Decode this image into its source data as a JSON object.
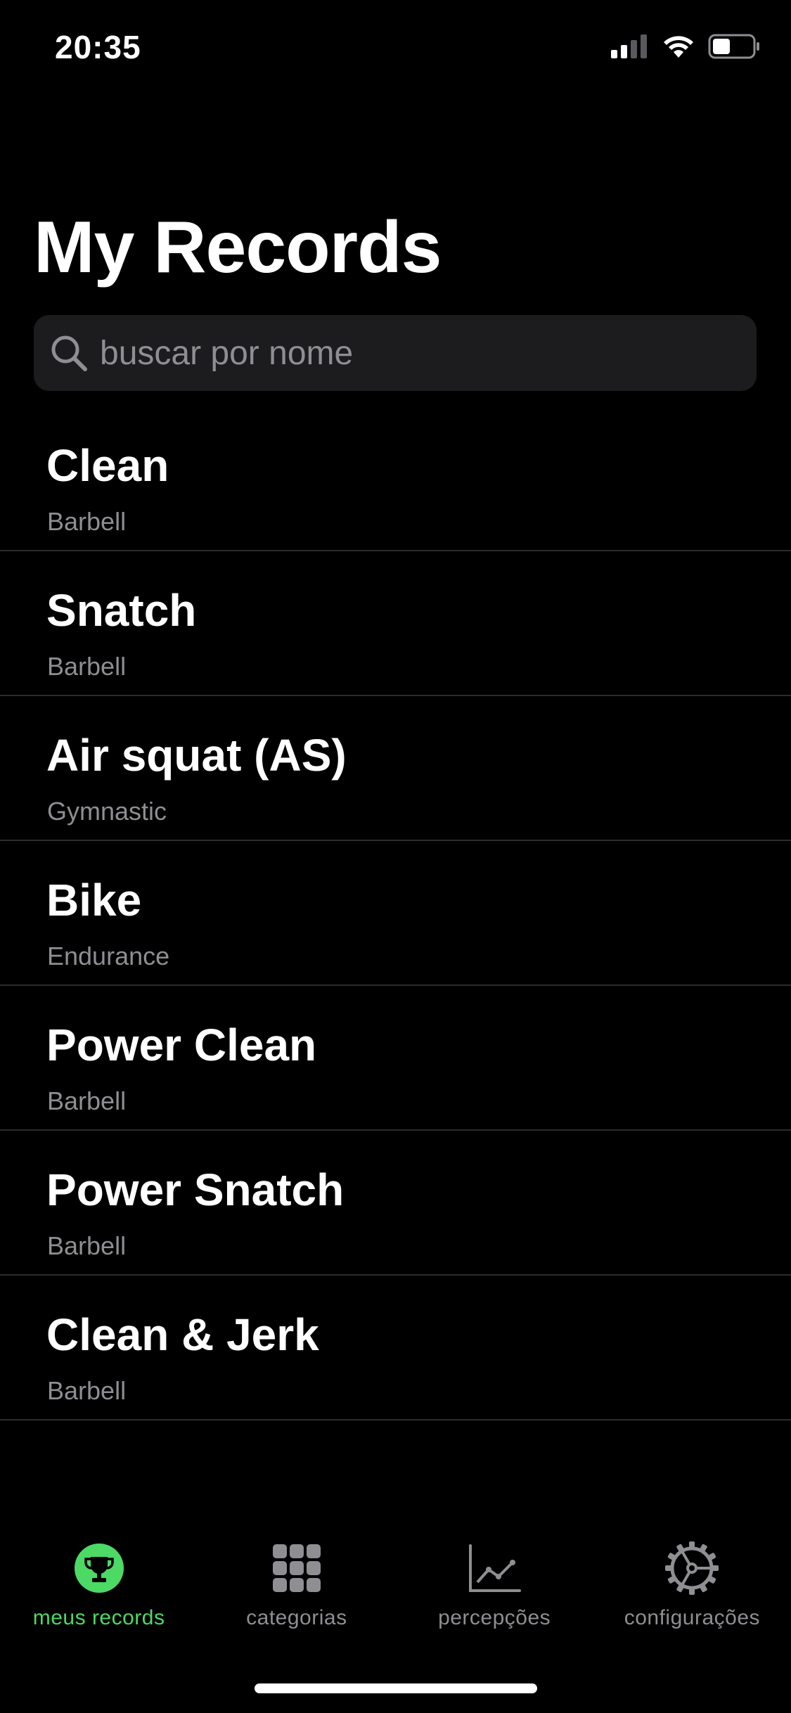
{
  "status_bar": {
    "time": "20:35"
  },
  "header": {
    "title": "My Records"
  },
  "search": {
    "placeholder": "buscar por nome",
    "value": ""
  },
  "records": [
    {
      "name": "Clean",
      "category": "Barbell"
    },
    {
      "name": "Snatch",
      "category": "Barbell"
    },
    {
      "name": "Air squat (AS)",
      "category": "Gymnastic"
    },
    {
      "name": "Bike",
      "category": "Endurance"
    },
    {
      "name": "Power Clean",
      "category": "Barbell"
    },
    {
      "name": "Power Snatch",
      "category": "Barbell"
    },
    {
      "name": "Clean & Jerk",
      "category": "Barbell"
    }
  ],
  "tab_bar": {
    "tabs": [
      {
        "label": "meus records",
        "icon": "trophy-icon",
        "active": true
      },
      {
        "label": "categorias",
        "icon": "grid-icon",
        "active": false
      },
      {
        "label": "percepções",
        "icon": "chart-icon",
        "active": false
      },
      {
        "label": "configurações",
        "icon": "gear-icon",
        "active": false
      }
    ]
  },
  "colors": {
    "background": "#000000",
    "accent": "#4cd964",
    "secondary_text": "#8e8e93",
    "search_background": "#1c1c1e",
    "separator": "#2c2c2e"
  }
}
